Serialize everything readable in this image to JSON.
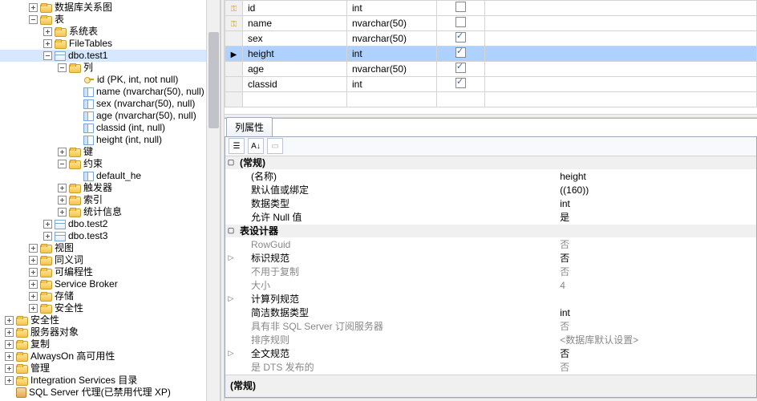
{
  "tree": [
    {
      "indent": 36,
      "tw": "plus",
      "ic": "folder",
      "label": "数据库关系图"
    },
    {
      "indent": 36,
      "tw": "minus",
      "ic": "folder",
      "label": "表"
    },
    {
      "indent": 54,
      "tw": "plus",
      "ic": "folder",
      "label": "系统表"
    },
    {
      "indent": 54,
      "tw": "plus",
      "ic": "folder",
      "label": "FileTables"
    },
    {
      "indent": 54,
      "tw": "minus",
      "ic": "table",
      "label": "dbo.test1",
      "selected": true
    },
    {
      "indent": 72,
      "tw": "minus",
      "ic": "folder",
      "label": "列"
    },
    {
      "indent": 90,
      "tw": "none",
      "ic": "key",
      "label": "id (PK, int, not null)"
    },
    {
      "indent": 90,
      "tw": "none",
      "ic": "col",
      "label": "name (nvarchar(50), null)"
    },
    {
      "indent": 90,
      "tw": "none",
      "ic": "col",
      "label": "sex (nvarchar(50), null)"
    },
    {
      "indent": 90,
      "tw": "none",
      "ic": "col",
      "label": "age (nvarchar(50), null)"
    },
    {
      "indent": 90,
      "tw": "none",
      "ic": "col",
      "label": "classid (int, null)"
    },
    {
      "indent": 90,
      "tw": "none",
      "ic": "col",
      "label": "height (int, null)"
    },
    {
      "indent": 72,
      "tw": "plus",
      "ic": "folder",
      "label": "键"
    },
    {
      "indent": 72,
      "tw": "minus",
      "ic": "folder",
      "label": "约束"
    },
    {
      "indent": 90,
      "tw": "none",
      "ic": "col",
      "label": "default_he"
    },
    {
      "indent": 72,
      "tw": "plus",
      "ic": "folder",
      "label": "触发器"
    },
    {
      "indent": 72,
      "tw": "plus",
      "ic": "folder",
      "label": "索引"
    },
    {
      "indent": 72,
      "tw": "plus",
      "ic": "folder",
      "label": "统计信息"
    },
    {
      "indent": 54,
      "tw": "plus",
      "ic": "table",
      "label": "dbo.test2"
    },
    {
      "indent": 54,
      "tw": "plus",
      "ic": "table",
      "label": "dbo.test3"
    },
    {
      "indent": 36,
      "tw": "plus",
      "ic": "folder",
      "label": "视图"
    },
    {
      "indent": 36,
      "tw": "plus",
      "ic": "folder",
      "label": "同义词"
    },
    {
      "indent": 36,
      "tw": "plus",
      "ic": "folder",
      "label": "可编程性"
    },
    {
      "indent": 36,
      "tw": "plus",
      "ic": "folder",
      "label": "Service Broker"
    },
    {
      "indent": 36,
      "tw": "plus",
      "ic": "folder",
      "label": "存储"
    },
    {
      "indent": 36,
      "tw": "plus",
      "ic": "folder",
      "label": "安全性"
    },
    {
      "indent": 6,
      "tw": "plus",
      "ic": "folder",
      "label": "安全性"
    },
    {
      "indent": 6,
      "tw": "plus",
      "ic": "folder",
      "label": "服务器对象"
    },
    {
      "indent": 6,
      "tw": "plus",
      "ic": "folder",
      "label": "复制"
    },
    {
      "indent": 6,
      "tw": "plus",
      "ic": "folder",
      "label": "AlwaysOn 高可用性"
    },
    {
      "indent": 6,
      "tw": "plus",
      "ic": "folder",
      "label": "管理"
    },
    {
      "indent": 6,
      "tw": "plus",
      "ic": "folder",
      "label": "Integration Services 目录"
    },
    {
      "indent": 6,
      "tw": "none",
      "ic": "agent",
      "label": "SQL Server 代理(已禁用代理 XP)"
    }
  ],
  "columns": [
    {
      "key": true,
      "arrow": false,
      "name": "id",
      "type": "int",
      "null": false,
      "sel": false
    },
    {
      "key": true,
      "arrow": false,
      "name": "name",
      "type": "nvarchar(50)",
      "null": false,
      "sel": false
    },
    {
      "key": false,
      "arrow": false,
      "name": "sex",
      "type": "nvarchar(50)",
      "null": true,
      "sel": false
    },
    {
      "key": false,
      "arrow": true,
      "name": "height",
      "type": "int",
      "null": true,
      "sel": true
    },
    {
      "key": false,
      "arrow": false,
      "name": "age",
      "type": "nvarchar(50)",
      "null": true,
      "sel": false
    },
    {
      "key": false,
      "arrow": false,
      "name": "classid",
      "type": "int",
      "null": true,
      "sel": false
    },
    {
      "key": false,
      "arrow": false,
      "name": "",
      "type": "",
      "null": false,
      "sel": false,
      "empty": true
    }
  ],
  "props_tab": "列属性",
  "props": [
    {
      "cat": true,
      "exp": "▢",
      "name": "(常规)",
      "val": ""
    },
    {
      "sub": true,
      "name": "(名称)",
      "val": "height"
    },
    {
      "sub": true,
      "name": "默认值或绑定",
      "val": "((160))"
    },
    {
      "sub": true,
      "name": "数据类型",
      "val": "int"
    },
    {
      "sub": true,
      "name": "允许 Null 值",
      "val": "是"
    },
    {
      "cat": true,
      "exp": "▢",
      "name": "表设计器",
      "val": ""
    },
    {
      "sub": true,
      "dim": true,
      "name": "RowGuid",
      "val": "否"
    },
    {
      "sub": true,
      "exp": "▷",
      "name": "标识规范",
      "val": "否"
    },
    {
      "sub": true,
      "dim": true,
      "name": "不用于复制",
      "val": "否"
    },
    {
      "sub": true,
      "dim": true,
      "name": "大小",
      "val": "4"
    },
    {
      "sub": true,
      "exp": "▷",
      "name": "计算列规范",
      "val": ""
    },
    {
      "sub": true,
      "name": "简洁数据类型",
      "val": "int"
    },
    {
      "sub": true,
      "dim": true,
      "name": "具有非 SQL Server 订阅服务器",
      "val": "否"
    },
    {
      "sub": true,
      "dim": true,
      "name": "排序规则",
      "val": "<数据库默认设置>"
    },
    {
      "sub": true,
      "exp": "▷",
      "name": "全文规范",
      "val": "否"
    },
    {
      "sub": true,
      "dim": true,
      "name": "是 DTS 发布的",
      "val": "否"
    }
  ],
  "footer_label": "(常规)"
}
